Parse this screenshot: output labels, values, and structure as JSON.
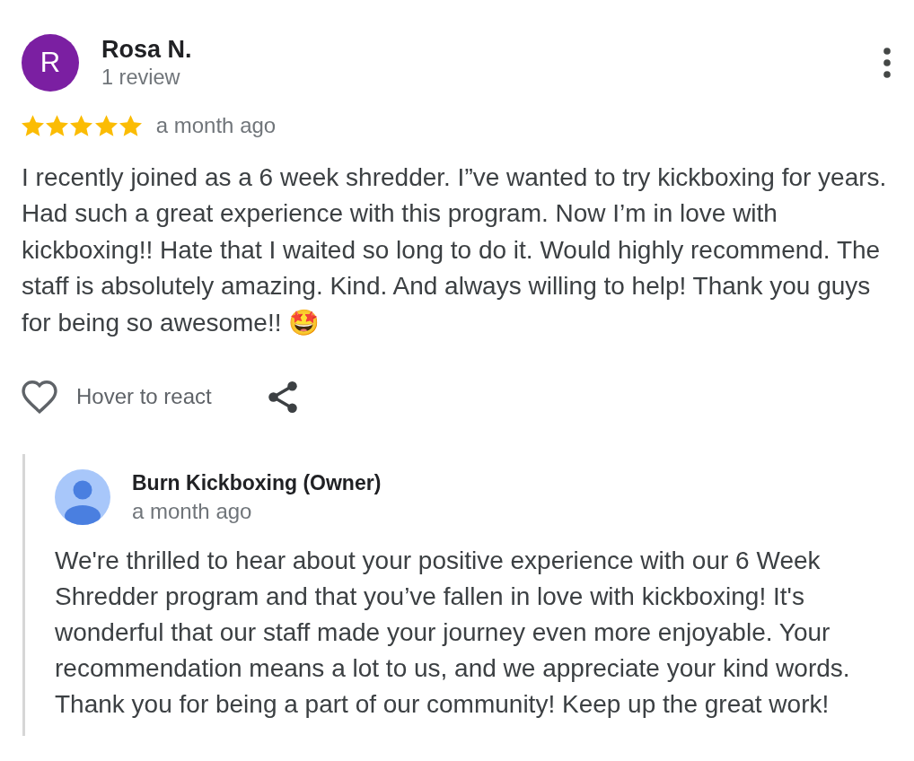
{
  "review": {
    "avatar_letter": "R",
    "author": "Rosa N.",
    "review_count": "1 review",
    "stars": 5,
    "time": "a month ago",
    "text": "I recently joined as a 6 week shredder. I”ve wanted to try kickboxing for years. Had such a great experience with this program. Now I’m in love with kickboxing!! Hate that I waited so long to do it. Would highly recommend. The staff is absolutely amazing. Kind. And always willing to help! Thank you guys for being so awesome!! 🤩"
  },
  "actions": {
    "react_label": "Hover to react"
  },
  "owner_reply": {
    "author": "Burn Kickboxing (Owner)",
    "time": "a month ago",
    "text": "We're thrilled to hear about your positive experience with our 6 Week Shredder program and that you’ve fallen in love with kickboxing! It's wonderful that our staff made your journey even more enjoyable. Your recommendation means a lot to us, and we appreciate your kind words. Thank you for being a part of our community! Keep up the great work!"
  }
}
